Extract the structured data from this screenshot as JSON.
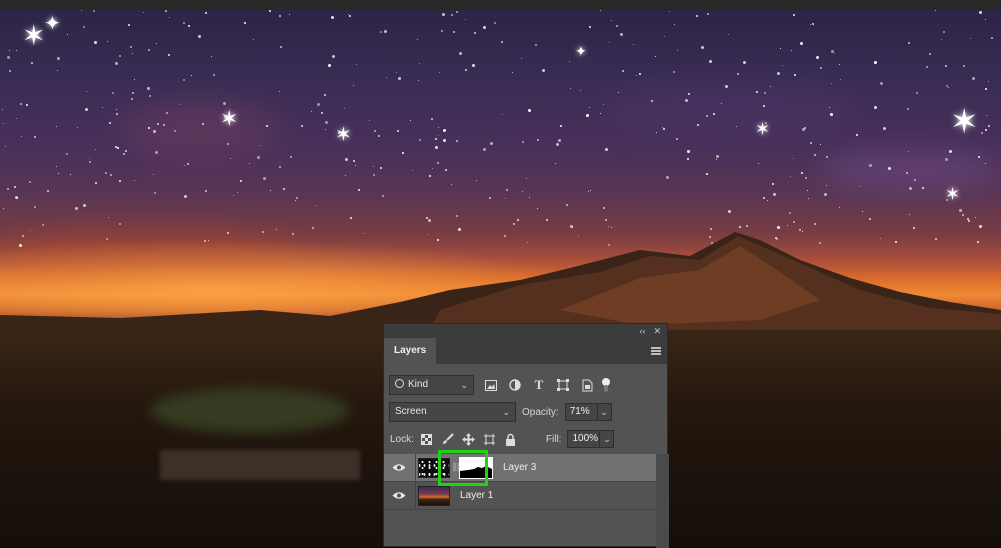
{
  "canvas": {
    "description_icons": [
      "star-sparkle-icon"
    ]
  },
  "panel": {
    "collapse_glyph": "‹‹",
    "close_glyph": "✕",
    "tab_label": "Layers",
    "filter": {
      "kind_label": "Kind"
    },
    "blend_mode": "Screen",
    "opacity_label": "Opacity:",
    "opacity_value": "71%",
    "lock_label": "Lock:",
    "fill_label": "Fill:",
    "fill_value": "100%",
    "layers": [
      {
        "name": "Layer 3",
        "selected": true,
        "has_mask": true
      },
      {
        "name": "Layer 1",
        "selected": false,
        "has_mask": false
      }
    ]
  },
  "colors": {
    "highlight": "#1fd314",
    "panel_bg": "#535353",
    "selected_row": "#717171"
  }
}
